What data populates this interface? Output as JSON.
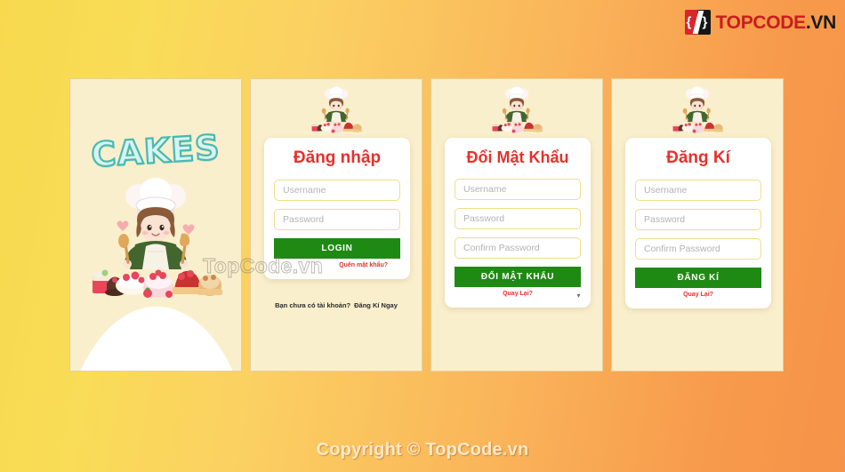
{
  "brand": {
    "mark_left_glyph": "{",
    "mark_right_glyph": "}",
    "name_part1": "TOPCODE",
    "name_part2": ".VN"
  },
  "watermark": "TopCode.vn",
  "footer": {
    "copyright": "Copyright © TopCode.vn"
  },
  "panels": {
    "hero": {
      "title_word": "CAKES"
    },
    "login": {
      "title": "Đăng nhập",
      "username_placeholder": "Username",
      "password_placeholder": "Password",
      "submit_label": "LOGIN",
      "forgot_link": "Quên mật khẩu?",
      "footer_question": "Bạn chưa có tài khoản?",
      "footer_action": "Đăng Kí Ngay"
    },
    "change_password": {
      "title": "Đổi Mật Khẩu",
      "username_placeholder": "Username",
      "password_placeholder": "Password",
      "confirm_placeholder": "Confirm Password",
      "submit_label": "ĐỔI MẬT KHẨU",
      "back_link": "Quay Lại?"
    },
    "signup": {
      "title": "Đăng Kí",
      "username_placeholder": "Username",
      "password_placeholder": "Password",
      "confirm_placeholder": "Confirm Password",
      "submit_label": "ĐĂNG KÍ",
      "back_link": "Quay Lại?"
    }
  },
  "colors": {
    "bg_start": "#f8d94e",
    "bg_end": "#f6934a",
    "panel_bg": "#faefcd",
    "title_red": "#e8302c",
    "button_green": "#1f8a13",
    "field_border": "#f0dd8a",
    "cakes_teal": "#49b9b1"
  }
}
